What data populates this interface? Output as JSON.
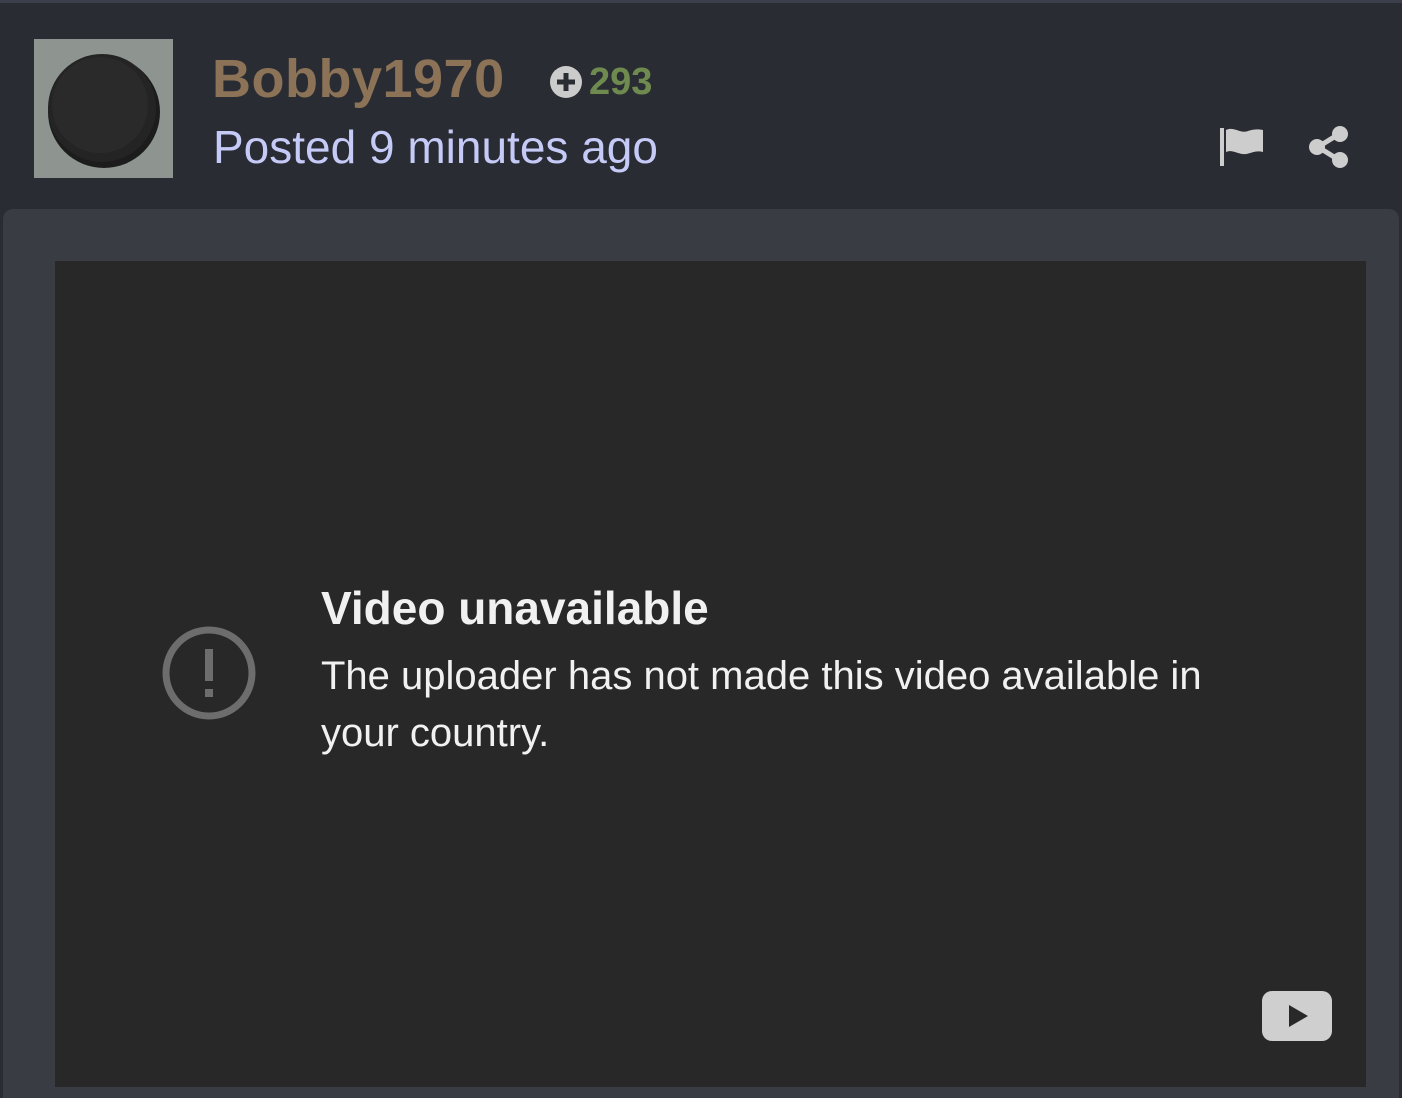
{
  "post": {
    "author": {
      "username": "Bobby1970",
      "avatar_description": "black circular object on gray background"
    },
    "reputation": {
      "icon": "plus-circle-icon",
      "count": "293"
    },
    "posted_time": "Posted 9 minutes ago",
    "actions": {
      "report_icon": "flag-icon",
      "share_icon": "share-icon"
    }
  },
  "video": {
    "status_icon": "alert-circle-icon",
    "title": "Video unavailable",
    "message": "The uploader has not made this video available in your country.",
    "platform_icon": "youtube-icon"
  },
  "colors": {
    "page_bg": "#292c33",
    "content_bg": "#393c43",
    "video_bg": "#282828",
    "username": "#8c7257",
    "reputation": "#6f8a4f",
    "posted_time": "#c6caf7",
    "icon_gray": "#cdcdcd"
  }
}
